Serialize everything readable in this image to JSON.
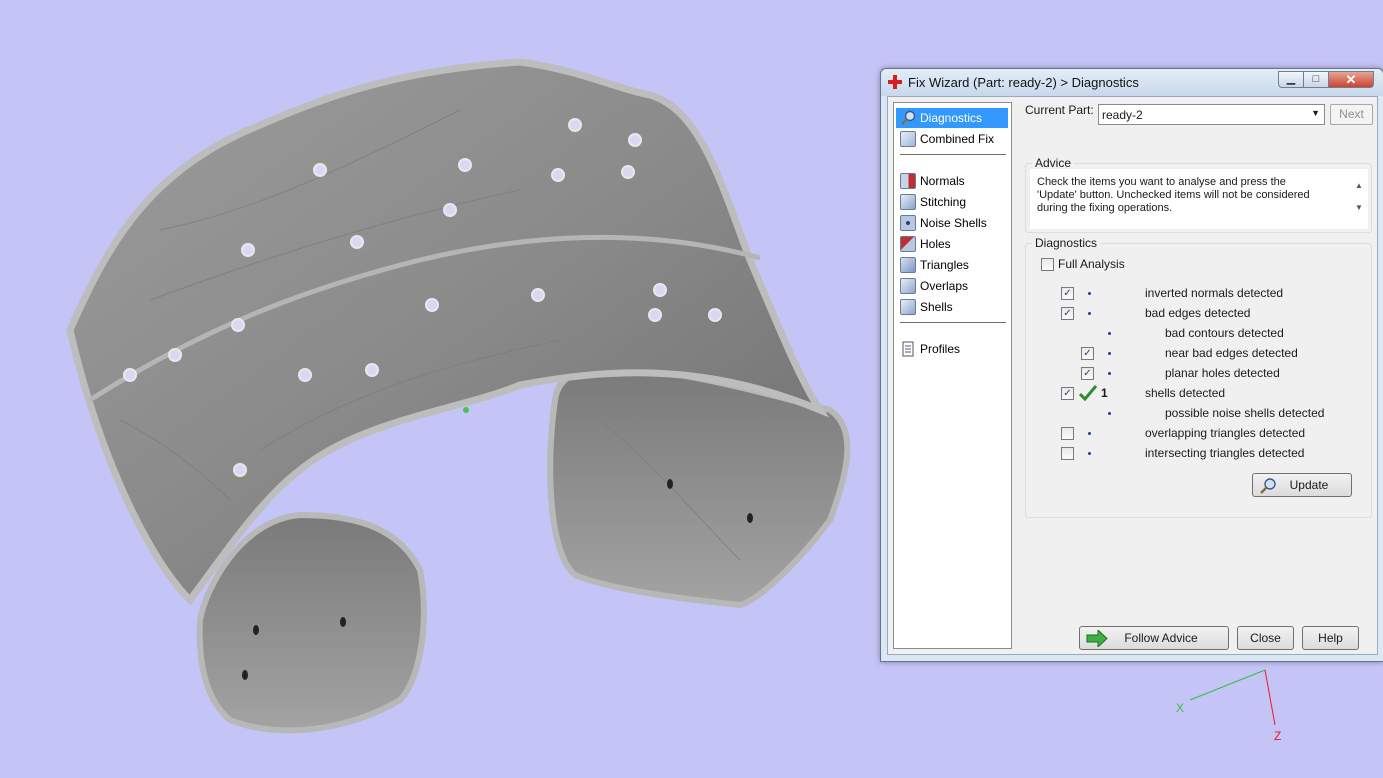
{
  "window": {
    "title": "Fix Wizard (Part: ready-2) > Diagnostics",
    "minimize_label": "▁",
    "maximize_label": "□",
    "close_label": "✕"
  },
  "nav": {
    "items": [
      {
        "label": "Diagnostics",
        "icon": "magnifier-icon"
      },
      {
        "label": "Combined Fix",
        "icon": "combined-fix-icon"
      },
      {
        "label": "Normals",
        "icon": "normals-icon"
      },
      {
        "label": "Stitching",
        "icon": "stitching-icon"
      },
      {
        "label": "Noise Shells",
        "icon": "noise-shells-icon"
      },
      {
        "label": "Holes",
        "icon": "holes-icon"
      },
      {
        "label": "Triangles",
        "icon": "triangles-icon"
      },
      {
        "label": "Overlaps",
        "icon": "overlaps-icon"
      },
      {
        "label": "Shells",
        "icon": "shells-icon"
      },
      {
        "label": "Profiles",
        "icon": "document-icon"
      }
    ]
  },
  "header": {
    "current_part_label": "Current Part:",
    "current_part_value": "ready-2",
    "next_label": "Next"
  },
  "advice": {
    "group_title": "Advice",
    "text": "Check the items you want to analyse and press the 'Update' button. Unchecked items will not be considered during the fixing operations."
  },
  "diagnostics": {
    "group_title": "Diagnostics",
    "full_analysis_label": "Full Analysis",
    "full_analysis_checked": false,
    "rows": [
      {
        "label": "inverted normals detected",
        "checked": true
      },
      {
        "label": "bad edges detected",
        "checked": true
      },
      {
        "label": "bad contours detected"
      },
      {
        "label": "near bad edges detected",
        "checked": true
      },
      {
        "label": "planar holes detected",
        "checked": true
      },
      {
        "label": "shells detected",
        "checked": true,
        "count": "1"
      },
      {
        "label": "possible noise shells detected"
      },
      {
        "label": "overlapping triangles detected",
        "checked": false
      },
      {
        "label": "intersecting triangles detected",
        "checked": false
      }
    ],
    "update_label": "Update"
  },
  "footer": {
    "follow_advice_label": "Follow Advice",
    "close_label": "Close",
    "help_label": "Help"
  },
  "axes": {
    "x_label": "X",
    "z_label": "Z"
  },
  "colors": {
    "background": "#c5c4f6",
    "selection": "#3399ff",
    "axis_x": "#30c040",
    "axis_z": "#e02020"
  }
}
